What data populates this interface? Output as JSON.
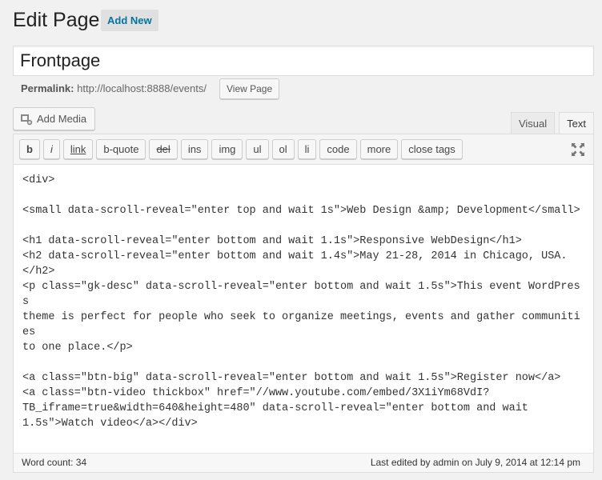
{
  "header": {
    "title": "Edit Page",
    "add_new": "Add New"
  },
  "post_title": {
    "value": "Frontpage"
  },
  "permalink": {
    "label": "Permalink:",
    "url": "http://localhost:8888/events/",
    "view_page": "View Page"
  },
  "media": {
    "add_media": "Add Media"
  },
  "editor_tabs": [
    {
      "label": "Visual",
      "active": false
    },
    {
      "label": "Text",
      "active": true
    }
  ],
  "quicktags": [
    "b",
    "i",
    "link",
    "b-quote",
    "del",
    "ins",
    "img",
    "ul",
    "ol",
    "li",
    "code",
    "more",
    "close tags"
  ],
  "content": "<div>\n\n<small data-scroll-reveal=\"enter top and wait 1s\">Web Design &amp; Development</small>\n\n<h1 data-scroll-reveal=\"enter bottom and wait 1.1s\">Responsive WebDesign</h1>\n<h2 data-scroll-reveal=\"enter bottom and wait 1.4s\">May 21-28, 2014 in Chicago, USA.\n</h2>\n<p class=\"gk-desc\" data-scroll-reveal=\"enter bottom and wait 1.5s\">This event WordPress\ntheme is perfect for people who seek to organize meetings, events and gather communities\nto one place.</p>\n\n<a class=\"btn-big\" data-scroll-reveal=\"enter bottom and wait 1.5s\">Register now</a>\n<a class=\"btn-video thickbox\" href=\"//www.youtube.com/embed/3X1iYm68VdI?\nTB_iframe=true&width=640&height=480\" data-scroll-reveal=\"enter bottom and wait\n1.5s\">Watch video</a></div>",
  "status": {
    "word_count": "Word count: 34",
    "last_edited": "Last edited by admin on July 9, 2014 at 12:14 pm"
  }
}
